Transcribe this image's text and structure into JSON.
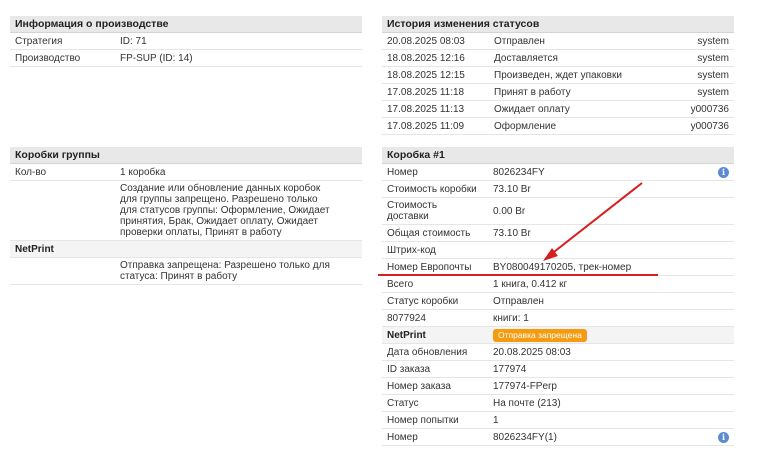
{
  "production": {
    "title": "Информация о производстве",
    "rows": [
      {
        "label": "Стратегия",
        "value": "ID: 71"
      },
      {
        "label": "Производство",
        "value": "FP-SUP (ID: 14)"
      }
    ]
  },
  "history": {
    "title": "История изменения статусов",
    "rows": [
      {
        "date": "20.08.2025 08:03",
        "status": "Отправлен",
        "user": "system"
      },
      {
        "date": "18.08.2025 12:16",
        "status": "Доставляется",
        "user": "system"
      },
      {
        "date": "18.08.2025 12:15",
        "status": "Произведен, ждет упаковки",
        "user": "system"
      },
      {
        "date": "17.08.2025 11:18",
        "status": "Принят в работу",
        "user": "system"
      },
      {
        "date": "17.08.2025 11:13",
        "status": "Ожидает оплату",
        "user": "y000736"
      },
      {
        "date": "17.08.2025 11:09",
        "status": "Оформление",
        "user": "y000736"
      }
    ]
  },
  "group_boxes": {
    "title": "Коробки группы",
    "count_label": "Кол-во",
    "count_value": "1 коробка",
    "create_note": "Создание или обновление данных коробок для группы запрещено. Разрешено только для статусов группы: Оформление, Ожидает принятия, Брак, Ожидает оплату, Ожидает проверки оплаты, Принят в работу",
    "netprint_label": "NetPrint",
    "netprint_note": "Отправка запрещена: Разрешено только для статуса: Принят в работу"
  },
  "box": {
    "title": "Коробка #1",
    "number_label": "Номер",
    "number_value": "8026234FY",
    "cost_label": "Стоимость коробки",
    "cost_value": "73.10 Br",
    "delivery_label": "Стоимость доставки",
    "delivery_value": "0.00 Br",
    "total_label": "Общая стоимость",
    "total_value": "73.10 Br",
    "barcode_label": "Штрих-код",
    "barcode_value": "",
    "europost_label": "Номер Европочты",
    "europost_value": "BY080049170205, трек-номер",
    "all_label": "Всего",
    "all_value": "1 книга, 0.412 кг",
    "status_label": "Статус коробки",
    "status_value": "Отправлен",
    "item_code": "8077924",
    "item_value": "книги: 1",
    "netprint_label": "NetPrint",
    "netprint_badge": "Отправка запрещена",
    "updated_label": "Дата обновления",
    "updated_value": "20.08.2025 08:03",
    "order_id_label": "ID заказа",
    "order_id_value": "177974",
    "order_no_label": "Номер заказа",
    "order_no_value": "177974-FPerp",
    "state_label": "Статус",
    "state_value": "На почте (213)",
    "attempt_label": "Номер попытки",
    "attempt_value": "1",
    "number2_label": "Номер",
    "number2_value": "8026234FY(1)",
    "info_glyph": "i"
  },
  "colors": {
    "header_bg": "#e8e8e8",
    "annotation_red": "#d62020",
    "badge_orange": "#f49b10",
    "info_blue": "#5b8bd0"
  }
}
